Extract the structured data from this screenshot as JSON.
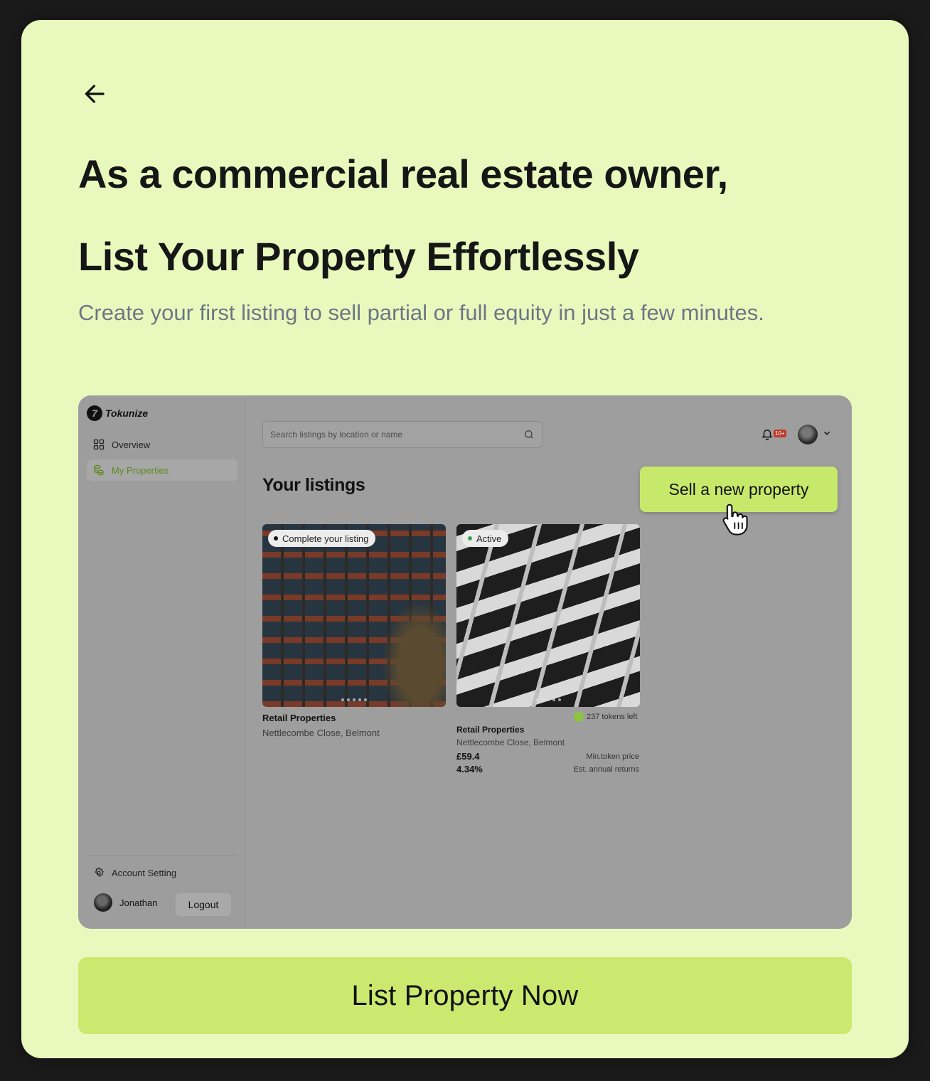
{
  "headline": {
    "line1": "As a commercial real estate owner,",
    "line2": "List Your Property Effortlessly",
    "subtitle": "Create your first listing to sell partial or full equity in just a few minutes."
  },
  "mockup": {
    "brand": "Tokunize",
    "sidebar": {
      "items": [
        {
          "label": "Overview",
          "icon": "grid-icon",
          "active": false
        },
        {
          "label": "My Properties",
          "icon": "coins-icon",
          "active": true
        }
      ],
      "account_setting": "Account Setting",
      "user_name": "Jonathan",
      "logout": "Logout"
    },
    "search_placeholder": "Search listings by location or name",
    "notification_badge": "10+",
    "page_title": "Your listings",
    "sell_button": "Sell a new property",
    "listings": [
      {
        "status": "Complete your listing",
        "title": "Retail Properties",
        "address": "Nettlecombe Close, Belmont"
      },
      {
        "status": "Active",
        "tokens_left": "237 tokens left",
        "title": "Retail Properties",
        "address": "Nettlecombe Close, Belmont",
        "price": "£59.4",
        "price_label": "Min.token price",
        "returns": "4.34%",
        "returns_label": "Est. annual returns"
      }
    ]
  },
  "cta_label": "List Property Now",
  "colors": {
    "background": "#e9f9bd",
    "accent": "#cbe96e",
    "subtitle": "#6e7685"
  }
}
